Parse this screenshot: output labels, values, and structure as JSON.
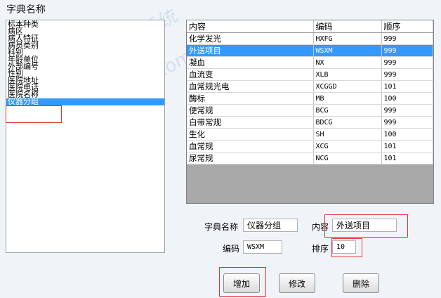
{
  "window": {
    "title": "字典名称"
  },
  "dictionary_list": {
    "items": [
      "标本种类",
      "病区",
      "病人特征",
      "病员类别",
      "科别",
      "年龄单位",
      "外部编号",
      "性别",
      "医院地址",
      "医院电话",
      "医院名称",
      "仪器分组"
    ],
    "selected_index": 11
  },
  "grid": {
    "columns": [
      "内容",
      "编码",
      "顺序"
    ],
    "rows": [
      {
        "name": "化学发光",
        "code": "HXFG",
        "order": "999"
      },
      {
        "name": "外送项目",
        "code": "WSXM",
        "order": "999"
      },
      {
        "name": "凝血",
        "code": "NX",
        "order": "999"
      },
      {
        "name": "血流变",
        "code": "XLB",
        "order": "999"
      },
      {
        "name": "血常规光电",
        "code": "XCGGD",
        "order": "101"
      },
      {
        "name": "酶标",
        "code": "MB",
        "order": "100"
      },
      {
        "name": "便常规",
        "code": "BCG",
        "order": "999"
      },
      {
        "name": "白带常规",
        "code": "BDCG",
        "order": "999"
      },
      {
        "name": "生化",
        "code": "SH",
        "order": "100"
      },
      {
        "name": "血常规",
        "code": "XCG",
        "order": "101"
      },
      {
        "name": "尿常规",
        "code": "NCG",
        "order": "101"
      }
    ],
    "selected_index": 1
  },
  "form": {
    "dict_name_label": "字典名称",
    "dict_name_value": "仪器分组",
    "content_label": "内容",
    "content_value": "外送项目",
    "code_label": "编码",
    "code_value": "WSXM",
    "order_label": "排序",
    "order_value": "10"
  },
  "buttons": {
    "add": "增加",
    "modify": "修改",
    "delete": "删除"
  },
  "watermark": {
    "cn": "实验室信息管理系统",
    "url": "www.sixinsoft.com"
  },
  "colors": {
    "selection": "#3399ff",
    "annotation": "#e53030",
    "background": "#f0f4f9"
  }
}
